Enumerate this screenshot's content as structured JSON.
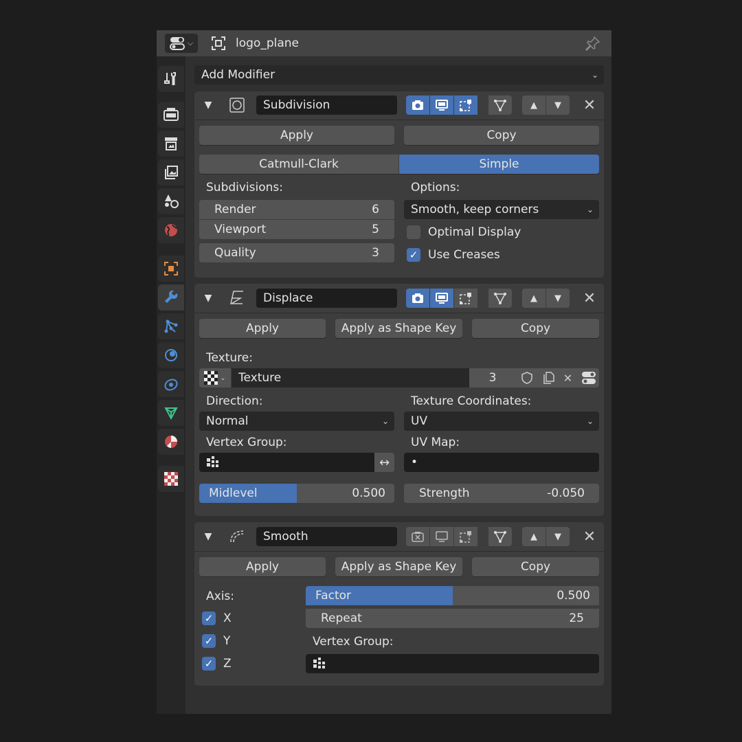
{
  "header": {
    "object_name": "logo_plane"
  },
  "add_modifier": {
    "label": "Add Modifier"
  },
  "subdivision": {
    "name": "Subdivision",
    "apply": "Apply",
    "copy": "Copy",
    "mode_catmull": "Catmull-Clark",
    "mode_simple": "Simple",
    "subdivisions_label": "Subdivisions:",
    "render_label": "Render",
    "render_value": "6",
    "viewport_label": "Viewport",
    "viewport_value": "5",
    "quality_label": "Quality",
    "quality_value": "3",
    "options_label": "Options:",
    "options_value": "Smooth, keep corners",
    "optimal_display": "Optimal Display",
    "optimal_display_checked": false,
    "use_creases": "Use Creases",
    "use_creases_checked": true
  },
  "displace": {
    "name": "Displace",
    "apply": "Apply",
    "apply_shape": "Apply as Shape Key",
    "copy": "Copy",
    "texture_label": "Texture:",
    "texture_name": "Texture",
    "texture_users": "3",
    "direction_label": "Direction:",
    "direction_value": "Normal",
    "tex_coords_label": "Texture Coordinates:",
    "tex_coords_value": "UV",
    "vertex_group_label": "Vertex Group:",
    "uv_map_label": "UV Map:",
    "uv_map_value": "•",
    "midlevel_label": "Midlevel",
    "midlevel_value": "0.500",
    "midlevel_fraction": 0.5,
    "strength_label": "Strength",
    "strength_value": "-0.050"
  },
  "smooth": {
    "name": "Smooth",
    "apply": "Apply",
    "apply_shape": "Apply as Shape Key",
    "copy": "Copy",
    "axis_label": "Axis:",
    "x": "X",
    "y": "Y",
    "z": "Z",
    "factor_label": "Factor",
    "factor_value": "0.500",
    "factor_fraction": 0.5,
    "repeat_label": "Repeat",
    "repeat_value": "25",
    "vertex_group_label": "Vertex Group:"
  },
  "colors": {
    "accent": "#4772b3",
    "panel": "#3d3d3d",
    "field": "#1d1d1d"
  }
}
